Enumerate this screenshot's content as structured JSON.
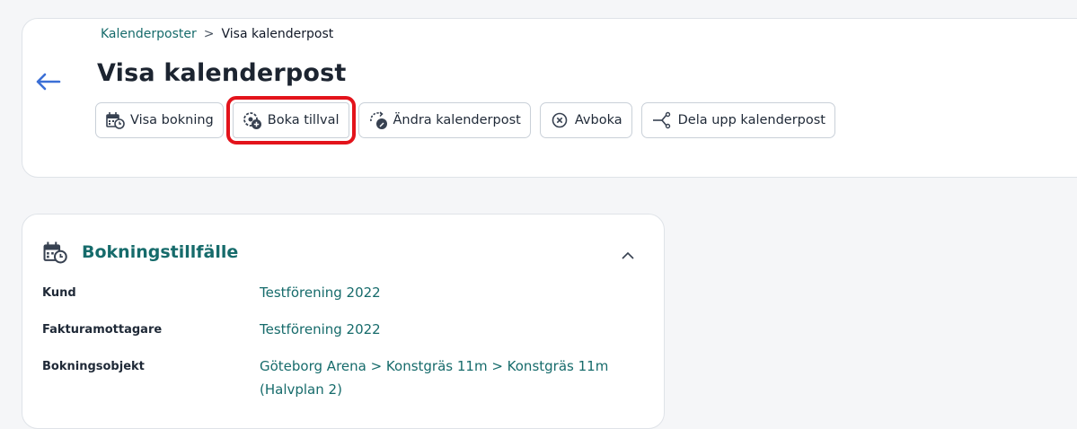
{
  "breadcrumb": {
    "parent": "Kalenderposter",
    "separator": ">",
    "current": "Visa kalenderpost"
  },
  "page_title": "Visa kalenderpost",
  "toolbar": {
    "visa_bokning": "Visa bokning",
    "boka_tillval": "Boka tillval",
    "andra_kalenderpost": "Ändra kalenderpost",
    "avboka": "Avboka",
    "dela_upp": "Dela upp kalenderpost"
  },
  "section": {
    "title": "Bokningstillfälle",
    "rows": [
      {
        "label": "Kund",
        "value": "Testförening 2022"
      },
      {
        "label": "Fakturamottagare",
        "value": "Testförening 2022"
      },
      {
        "label": "Bokningsobjekt",
        "value": "Göteborg Arena > Konstgräs 11m > Konstgräs 11m (Halvplan 2)"
      }
    ]
  },
  "colors": {
    "accent": "#166b6b",
    "highlight": "#e3131b",
    "back_arrow": "#3b6fd6"
  }
}
